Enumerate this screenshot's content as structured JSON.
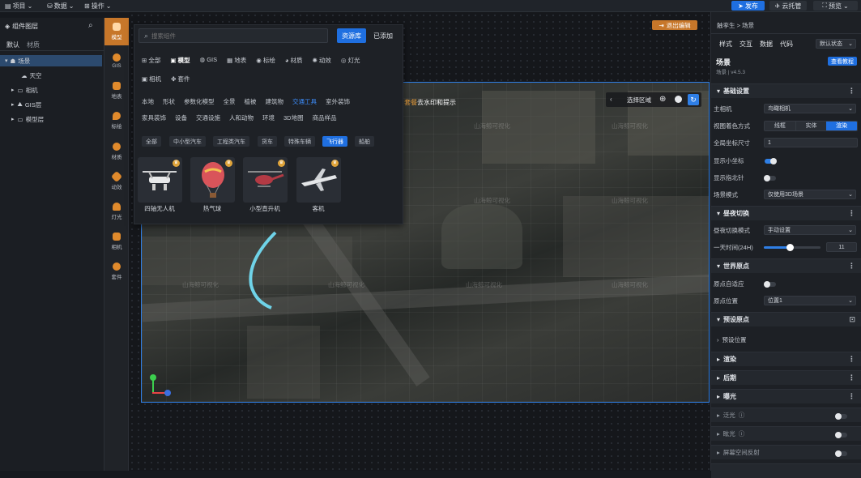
{
  "topbar": {
    "project": "项目",
    "data": "数据",
    "operate": "操作",
    "publish": "发布",
    "cloud": "云托管",
    "preview": "预览"
  },
  "left": {
    "title": "组件图层",
    "tabs": [
      "默认",
      "材质"
    ],
    "tree": [
      {
        "label": "场景",
        "level": 0,
        "selected": true
      },
      {
        "label": "天空",
        "level": 1
      },
      {
        "label": "相机",
        "level": 1
      },
      {
        "label": "GIS层",
        "level": 1
      },
      {
        "label": "模型层",
        "level": 1
      }
    ]
  },
  "rail": [
    "模型",
    "GIS",
    "地表",
    "标绘",
    "材质",
    "动效",
    "灯光",
    "相机",
    "套件"
  ],
  "popup": {
    "search_placeholder": "搜索组件",
    "lib_btn": "资源库",
    "added_btn": "已添加",
    "cats": [
      "全部",
      "模型",
      "GIS",
      "地表",
      "标绘",
      "材质",
      "动效",
      "灯光",
      "相机",
      "套件"
    ],
    "subcats1": [
      "本地",
      "形状",
      "参数化模型",
      "全景",
      "植被",
      "建筑物",
      "交通工具",
      "室外装饰"
    ],
    "subcats2": [
      "家具装饰",
      "设备",
      "交通设施",
      "人和动物",
      "环境",
      "3D地图",
      "商品样品"
    ],
    "chips": [
      "全部",
      "中小型汽车",
      "工程类汽车",
      "货车",
      "特殊车辆",
      "飞行器",
      "船舶"
    ],
    "items": [
      "四轴无人机",
      "热气球",
      "小型直升机",
      "客机"
    ]
  },
  "canvas": {
    "exit_edit": "退出编辑",
    "hint_prefix": "套餐",
    "hint_text": "去水印和提示",
    "select_area": "选择区域",
    "watermark": "山海鲸可视化"
  },
  "right": {
    "breadcrumb": "触孪生 > 场景",
    "tabs": [
      "样式",
      "交互",
      "数据",
      "代码"
    ],
    "state": "默认状态",
    "scene_title": "场景",
    "scene_sub": "场景 | v4.5.3",
    "tutorial": "查看教程",
    "s_basic": "基础设置",
    "main_camera_lbl": "主相机",
    "main_camera": "鸟瞰相机",
    "view_color_lbl": "视图着色方式",
    "view_modes": [
      "线框",
      "实体",
      "渲染"
    ],
    "coord_lbl": "全局坐标尺寸",
    "coord_val": "1",
    "show_axis": "显示小坐标",
    "show_compass": "显示指北针",
    "scene_mode_lbl": "场景模式",
    "scene_mode": "仅使用3D场景",
    "s_daynight": "昼夜切换",
    "dn_mode_lbl": "昼夜切换模式",
    "dn_mode": "手动设置",
    "time_lbl": "一天时间(24H)",
    "time_val": "11",
    "time_frac": 0.46,
    "s_origin": "世界原点",
    "auto_origin": "原点自适应",
    "origin_pos_lbl": "原点位置",
    "origin_pos": "位置1",
    "s_preset": "预设原点",
    "preset_pos": "预设位置",
    "s_render": "渲染",
    "s_post": "后期",
    "s_exposure": "曝光",
    "flood": "泛光",
    "glare": "眩光",
    "ssr": "屏幕空间反射"
  }
}
